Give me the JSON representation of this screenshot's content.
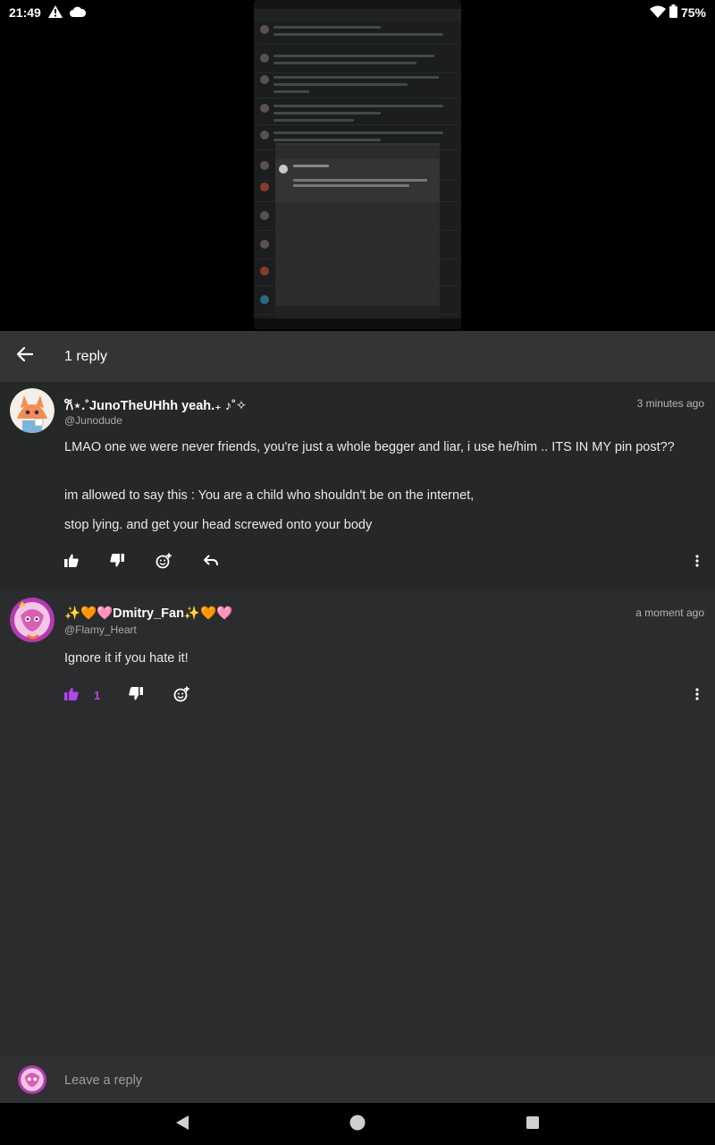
{
  "status_bar": {
    "time": "21:49",
    "battery": "75%",
    "icons": [
      "alert-icon",
      "cloud-icon",
      "wifi-icon",
      "battery-icon"
    ]
  },
  "header": {
    "title": "1 reply",
    "back_icon": "arrow-left-icon"
  },
  "comments": [
    {
      "author": "𐙚⋆.˚JunoTheUHhh yeah.₊ ♪˚✧",
      "handle": "@Junodude",
      "time": "3 minutes ago",
      "paragraphs": [
        "LMAO one we were never friends, you're just a whole begger and liar, i use he/him .. ITS IN MY pin post??",
        "im allowed to say this : You are a child who shouldn't be on the internet,",
        "stop lying. and get your head screwed onto your body"
      ],
      "liked": false
    },
    {
      "author": "✨🧡🩷Dmitry_Fan✨🧡🩷",
      "handle": "@Flamy_Heart",
      "time": "a moment ago",
      "paragraphs": [
        "Ignore it if you hate it!"
      ],
      "liked": true,
      "likes": "1"
    }
  ],
  "reply_bar": {
    "placeholder": "Leave a reply"
  },
  "colors": {
    "accent": "#b246f0",
    "panel": "#2b2c2d",
    "header": "#333435",
    "first_comment": "#262727"
  }
}
